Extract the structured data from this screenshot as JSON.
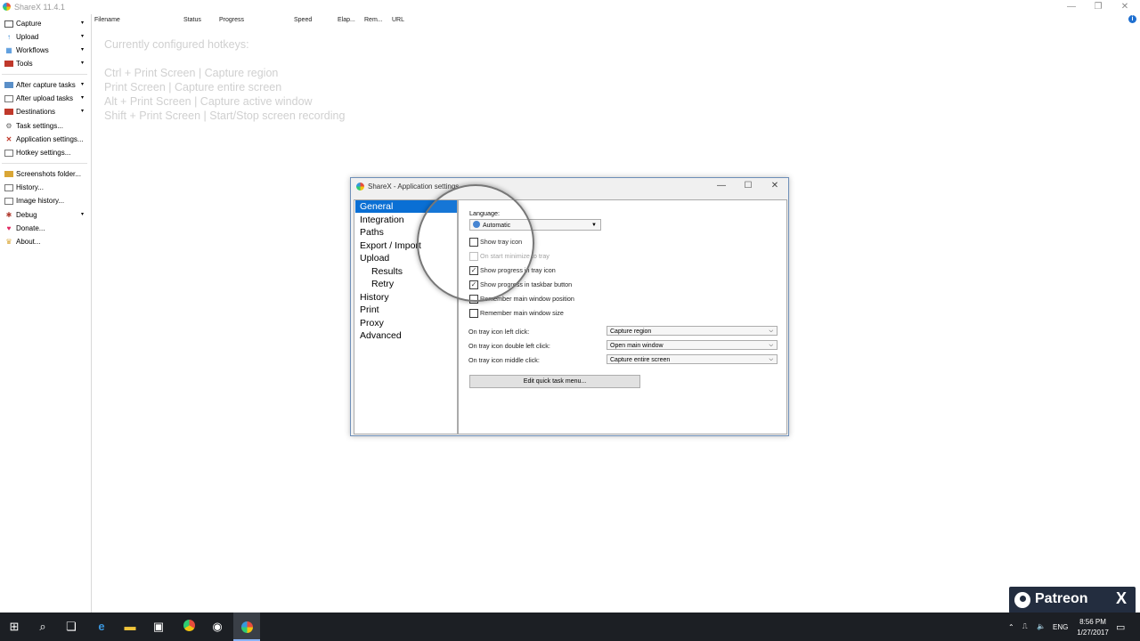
{
  "window": {
    "title": "ShareX 11.4.1"
  },
  "sidebar": {
    "items": [
      {
        "label": "Capture",
        "icon": "capture-icon",
        "arrow": "▾"
      },
      {
        "label": "Upload",
        "icon": "upload-icon",
        "arrow": "▾"
      },
      {
        "label": "Workflows",
        "icon": "workflows-icon",
        "arrow": "▾"
      },
      {
        "label": "Tools",
        "icon": "tools-icon",
        "arrow": "▾"
      },
      {
        "label": "After capture tasks",
        "icon": "after-capture-icon",
        "arrow": "▾"
      },
      {
        "label": "After upload tasks",
        "icon": "after-upload-icon",
        "arrow": "▾"
      },
      {
        "label": "Destinations",
        "icon": "destinations-icon",
        "arrow": "▾"
      },
      {
        "label": "Task settings...",
        "icon": "gear-icon"
      },
      {
        "label": "Application settings...",
        "icon": "wrench-icon"
      },
      {
        "label": "Hotkey settings...",
        "icon": "keyboard-icon"
      },
      {
        "label": "Screenshots folder...",
        "icon": "folder-icon"
      },
      {
        "label": "History...",
        "icon": "history-icon"
      },
      {
        "label": "Image history...",
        "icon": "image-history-icon"
      },
      {
        "label": "Debug",
        "icon": "bug-icon",
        "arrow": "▾"
      },
      {
        "label": "Donate...",
        "icon": "heart-icon"
      },
      {
        "label": "About...",
        "icon": "crown-icon"
      }
    ]
  },
  "columns": [
    "Filename",
    "Status",
    "Progress",
    "Speed",
    "Elap...",
    "Rem...",
    "URL"
  ],
  "hotkeys": {
    "heading": "Currently configured hotkeys:",
    "lines": [
      "Ctrl + Print Screen  |  Capture region",
      "Print Screen  |  Capture entire screen",
      "Alt + Print Screen  |  Capture active window",
      "Shift + Print Screen  |  Start/Stop screen recording"
    ]
  },
  "dialog": {
    "title": "ShareX - Application settings",
    "nav": [
      "General",
      "Integration",
      "Paths",
      "Export / Import",
      "Upload",
      "Results",
      "Retry",
      "History",
      "Print",
      "Proxy",
      "Advanced"
    ],
    "language_label": "Language:",
    "language_value": "Automatic",
    "checkboxes": [
      {
        "label": "Show tray icon",
        "checked": false,
        "enabled": true
      },
      {
        "label": "On start minimize to tray",
        "checked": false,
        "enabled": false
      },
      {
        "label": "Show progress in tray icon",
        "checked": true,
        "enabled": true
      },
      {
        "label": "Show progress in taskbar button",
        "checked": true,
        "enabled": true
      },
      {
        "label": "Remember main window position",
        "checked": false,
        "enabled": true
      },
      {
        "label": "Remember main window size",
        "checked": false,
        "enabled": true
      }
    ],
    "tray_actions": [
      {
        "label": "On tray icon left click:",
        "value": "Capture region"
      },
      {
        "label": "On tray icon double left click:",
        "value": "Open main window"
      },
      {
        "label": "On tray icon middle click:",
        "value": "Capture entire screen"
      }
    ],
    "edit_button": "Edit quick task menu..."
  },
  "taskbar": {
    "lang": "ENG",
    "time": "8:56 PM",
    "date": "1/27/2017"
  },
  "patreon": {
    "label": "Patreon",
    "mark": "X"
  },
  "colors": {
    "accent": "#0a6fd4",
    "taskbar": "#1c1f24",
    "patreon": "#232d3f"
  }
}
